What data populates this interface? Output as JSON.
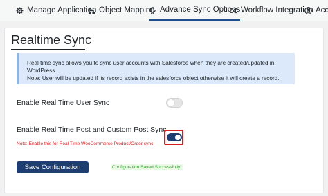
{
  "tabs": [
    {
      "icon": "gear-icon",
      "label": "Manage Application"
    },
    {
      "icon": "mapping-icon",
      "label": "Object Mapping"
    },
    {
      "icon": "sync-icon",
      "label": "Advance Sync Options"
    },
    {
      "icon": "shuffle-icon",
      "label": "Workflow Integration"
    },
    {
      "icon": "user-icon",
      "label": "Acco"
    }
  ],
  "active_tab": 2,
  "page": {
    "title": "Realtime Sync",
    "info_line1": "Real time sync allows you to sync user accounts with Salesforce when they are created/updated in WordPress.",
    "info_line2": "Note: User will be updated if its record exists in the salesforce object otherwise it will create a record.",
    "user_sync_label": "Enable Real Time User Sync",
    "user_sync_enabled": false,
    "post_sync_label": "Enable Real Time Post and Custom Post Sync",
    "post_sync_enabled": true,
    "post_sync_note": "Note: Enable this for Real Time WooCommerce Product/Order sync",
    "save_label": "Save Configuration",
    "success_message": "Configuration Saved Successfully!"
  },
  "colors": {
    "accent": "#1e3d70",
    "info_bg": "#dbe9fb",
    "note_red": "#d41f1f",
    "success_green": "#2e9e2e"
  }
}
